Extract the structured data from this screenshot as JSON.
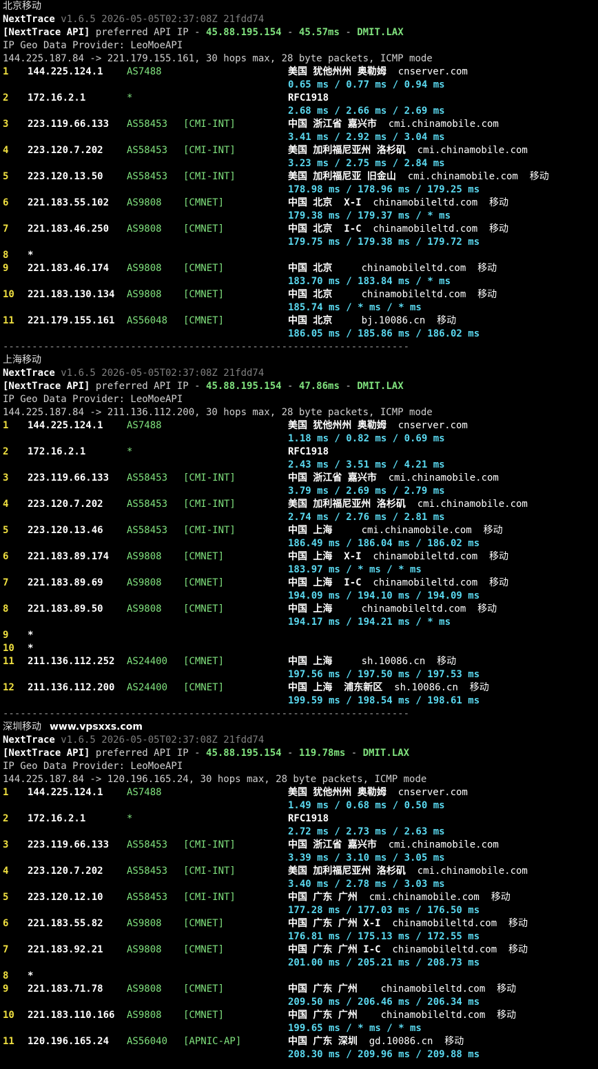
{
  "sections": [
    {
      "name": "北京移动",
      "site": "",
      "banner": {
        "app": "NextTrace",
        "ver": "v1.6.5 2026-05-05T02:37:08Z 21fdd74"
      },
      "api": {
        "label": "[NextTrace API]",
        "mid": " preferred API IP - ",
        "ip": "45.88.195.154",
        "dash1": " - ",
        "latency": "45.57ms",
        "dash2": " - ",
        "pop": "DMIT.LAX"
      },
      "geo_provider": "IP Geo Data Provider: LeoMoeAPI",
      "route": "144.225.187.84 -> 221.179.155.161, 30 hops max, 28 byte packets, ICMP mode",
      "hops": [
        {
          "n": "1",
          "ip": "144.225.124.1",
          "asn": "AS7488",
          "tag": "",
          "geo": "美国 犹他州州 奥勒姆",
          "host": "cnserver.com",
          "isp": "",
          "rtt": "0.65 ms / 0.77 ms / 0.94 ms"
        },
        {
          "n": "2",
          "ip": "172.16.2.1",
          "asn": "*",
          "tag": "",
          "geo": "RFC1918",
          "host": "",
          "isp": "",
          "rtt": "2.68 ms / 2.66 ms / 2.69 ms"
        },
        {
          "n": "3",
          "ip": "223.119.66.133",
          "asn": "AS58453",
          "tag": "[CMI-INT]",
          "geo": "中国 浙江省 嘉兴市",
          "host": "cmi.chinamobile.com",
          "isp": "",
          "rtt": "3.41 ms / 2.92 ms / 3.04 ms"
        },
        {
          "n": "4",
          "ip": "223.120.7.202",
          "asn": "AS58453",
          "tag": "[CMI-INT]",
          "geo": "美国 加利福尼亚州 洛杉矶",
          "host": "cmi.chinamobile.com",
          "isp": "",
          "rtt": "3.23 ms / 2.75 ms / 2.84 ms"
        },
        {
          "n": "5",
          "ip": "223.120.13.50",
          "asn": "AS58453",
          "tag": "[CMI-INT]",
          "geo": "美国 加利福尼亚 旧金山",
          "host": "cmi.chinamobile.com",
          "isp": "移动",
          "rtt": "178.98 ms / 178.96 ms / 179.25 ms"
        },
        {
          "n": "6",
          "ip": "221.183.55.102",
          "asn": "AS9808",
          "tag": "[CMNET]",
          "geo": "中国 北京  X-I",
          "host": "chinamobileltd.com",
          "isp": "移动",
          "rtt": "179.38 ms / 179.37 ms / * ms"
        },
        {
          "n": "7",
          "ip": "221.183.46.250",
          "asn": "AS9808",
          "tag": "[CMNET]",
          "geo": "中国 北京  I-C",
          "host": "chinamobileltd.com",
          "isp": "移动",
          "rtt": "179.75 ms / 179.38 ms / 179.72 ms"
        },
        {
          "n": "8",
          "ip": "*",
          "asn": "",
          "tag": "",
          "geo": "",
          "host": "",
          "isp": "",
          "rtt": ""
        },
        {
          "n": "9",
          "ip": "221.183.46.174",
          "asn": "AS9808",
          "tag": "[CMNET]",
          "geo": "中国 北京   ",
          "host": "chinamobileltd.com",
          "isp": "移动",
          "rtt": "183.70 ms / 183.84 ms / * ms"
        },
        {
          "n": "10",
          "ip": "221.183.130.134",
          "asn": "AS9808",
          "tag": "[CMNET]",
          "geo": "中国 北京   ",
          "host": "chinamobileltd.com",
          "isp": "移动",
          "rtt": "185.74 ms / * ms / * ms"
        },
        {
          "n": "11",
          "ip": "221.179.155.161",
          "asn": "AS56048",
          "tag": "[CMNET]",
          "geo": "中国 北京   ",
          "host": "bj.10086.cn",
          "isp": "移动",
          "rtt": "186.05 ms / 185.86 ms / 186.02 ms"
        }
      ]
    },
    {
      "name": "上海移动",
      "site": "",
      "banner": {
        "app": "NextTrace",
        "ver": "v1.6.5 2026-05-05T02:37:08Z 21fdd74"
      },
      "api": {
        "label": "[NextTrace API]",
        "mid": " preferred API IP - ",
        "ip": "45.88.195.154",
        "dash1": " - ",
        "latency": "47.86ms",
        "dash2": " - ",
        "pop": "DMIT.LAX"
      },
      "geo_provider": "IP Geo Data Provider: LeoMoeAPI",
      "route": "144.225.187.84 -> 211.136.112.200, 30 hops max, 28 byte packets, ICMP mode",
      "hops": [
        {
          "n": "1",
          "ip": "144.225.124.1",
          "asn": "AS7488",
          "tag": "",
          "geo": "美国 犹他州州 奥勒姆",
          "host": "cnserver.com",
          "isp": "",
          "rtt": "1.18 ms / 0.82 ms / 0.69 ms"
        },
        {
          "n": "2",
          "ip": "172.16.2.1",
          "asn": "*",
          "tag": "",
          "geo": "RFC1918",
          "host": "",
          "isp": "",
          "rtt": "2.43 ms / 3.51 ms / 4.21 ms"
        },
        {
          "n": "3",
          "ip": "223.119.66.133",
          "asn": "AS58453",
          "tag": "[CMI-INT]",
          "geo": "中国 浙江省 嘉兴市",
          "host": "cmi.chinamobile.com",
          "isp": "",
          "rtt": "3.79 ms / 2.69 ms / 2.79 ms"
        },
        {
          "n": "4",
          "ip": "223.120.7.202",
          "asn": "AS58453",
          "tag": "[CMI-INT]",
          "geo": "美国 加利福尼亚州 洛杉矶",
          "host": "cmi.chinamobile.com",
          "isp": "",
          "rtt": "2.74 ms / 2.76 ms / 2.81 ms"
        },
        {
          "n": "5",
          "ip": "223.120.13.46",
          "asn": "AS58453",
          "tag": "[CMI-INT]",
          "geo": "中国 上海   ",
          "host": "cmi.chinamobile.com",
          "isp": "移动",
          "rtt": "186.49 ms / 186.04 ms / 186.02 ms"
        },
        {
          "n": "6",
          "ip": "221.183.89.174",
          "asn": "AS9808",
          "tag": "[CMNET]",
          "geo": "中国 上海  X-I",
          "host": "chinamobileltd.com",
          "isp": "移动",
          "rtt": "183.97 ms / * ms / * ms"
        },
        {
          "n": "7",
          "ip": "221.183.89.69",
          "asn": "AS9808",
          "tag": "[CMNET]",
          "geo": "中国 上海  I-C",
          "host": "chinamobileltd.com",
          "isp": "移动",
          "rtt": "194.09 ms / 194.10 ms / 194.09 ms"
        },
        {
          "n": "8",
          "ip": "221.183.89.50",
          "asn": "AS9808",
          "tag": "[CMNET]",
          "geo": "中国 上海   ",
          "host": "chinamobileltd.com",
          "isp": "移动",
          "rtt": "194.17 ms / 194.21 ms / * ms"
        },
        {
          "n": "9",
          "ip": "*",
          "asn": "",
          "tag": "",
          "geo": "",
          "host": "",
          "isp": "",
          "rtt": ""
        },
        {
          "n": "10",
          "ip": "*",
          "asn": "",
          "tag": "",
          "geo": "",
          "host": "",
          "isp": "",
          "rtt": ""
        },
        {
          "n": "11",
          "ip": "211.136.112.252",
          "asn": "AS24400",
          "tag": "[CMNET]",
          "geo": "中国 上海   ",
          "host": "sh.10086.cn",
          "isp": "移动",
          "rtt": "197.56 ms / 197.50 ms / 197.53 ms"
        },
        {
          "n": "12",
          "ip": "211.136.112.200",
          "asn": "AS24400",
          "tag": "[CMNET]",
          "geo": "中国 上海  浦东新区",
          "host": "sh.10086.cn",
          "isp": "移动",
          "rtt": "199.59 ms / 198.54 ms / 198.61 ms"
        }
      ]
    },
    {
      "name": "深圳移动",
      "site": "www.vpsxxs.com",
      "banner": {
        "app": "NextTrace",
        "ver": "v1.6.5 2026-05-05T02:37:08Z 21fdd74"
      },
      "api": {
        "label": "[NextTrace API]",
        "mid": " preferred API IP - ",
        "ip": "45.88.195.154",
        "dash1": " - ",
        "latency": "119.78ms",
        "dash2": " - ",
        "pop": "DMIT.LAX"
      },
      "geo_provider": "IP Geo Data Provider: LeoMoeAPI",
      "route": "144.225.187.84 -> 120.196.165.24, 30 hops max, 28 byte packets, ICMP mode",
      "hops": [
        {
          "n": "1",
          "ip": "144.225.124.1",
          "asn": "AS7488",
          "tag": "",
          "geo": "美国 犹他州州 奥勒姆",
          "host": "cnserver.com",
          "isp": "",
          "rtt": "1.49 ms / 0.68 ms / 0.50 ms"
        },
        {
          "n": "2",
          "ip": "172.16.2.1",
          "asn": "*",
          "tag": "",
          "geo": "RFC1918",
          "host": "",
          "isp": "",
          "rtt": "2.72 ms / 2.73 ms / 2.63 ms"
        },
        {
          "n": "3",
          "ip": "223.119.66.133",
          "asn": "AS58453",
          "tag": "[CMI-INT]",
          "geo": "中国 浙江省 嘉兴市",
          "host": "cmi.chinamobile.com",
          "isp": "",
          "rtt": "3.39 ms / 3.10 ms / 3.05 ms"
        },
        {
          "n": "4",
          "ip": "223.120.7.202",
          "asn": "AS58453",
          "tag": "[CMI-INT]",
          "geo": "美国 加利福尼亚州 洛杉矶",
          "host": "cmi.chinamobile.com",
          "isp": "",
          "rtt": "3.40 ms / 2.78 ms / 3.03 ms"
        },
        {
          "n": "5",
          "ip": "223.120.12.10",
          "asn": "AS58453",
          "tag": "[CMI-INT]",
          "geo": "中国 广东 广州",
          "host": "cmi.chinamobile.com",
          "isp": "移动",
          "rtt": "177.28 ms / 177.03 ms / 176.50 ms"
        },
        {
          "n": "6",
          "ip": "221.183.55.82",
          "asn": "AS9808",
          "tag": "[CMNET]",
          "geo": "中国 广东 广州 X-I",
          "host": "chinamobileltd.com",
          "isp": "移动",
          "rtt": "176.81 ms / 175.13 ms / 172.55 ms"
        },
        {
          "n": "7",
          "ip": "221.183.92.21",
          "asn": "AS9808",
          "tag": "[CMNET]",
          "geo": "中国 广东 广州 I-C",
          "host": "chinamobileltd.com",
          "isp": "移动",
          "rtt": "201.00 ms / 205.21 ms / 208.73 ms"
        },
        {
          "n": "8",
          "ip": "*",
          "asn": "",
          "tag": "",
          "geo": "",
          "host": "",
          "isp": "",
          "rtt": ""
        },
        {
          "n": "9",
          "ip": "221.183.71.78",
          "asn": "AS9808",
          "tag": "[CMNET]",
          "geo": "中国 广东 广州  ",
          "host": "chinamobileltd.com",
          "isp": "移动",
          "rtt": "209.50 ms / 206.46 ms / 206.34 ms"
        },
        {
          "n": "10",
          "ip": "221.183.110.166",
          "asn": "AS9808",
          "tag": "[CMNET]",
          "geo": "中国 广东 广州  ",
          "host": "chinamobileltd.com",
          "isp": "移动",
          "rtt": "199.65 ms / * ms / * ms"
        },
        {
          "n": "11",
          "ip": "120.196.165.24",
          "asn": "AS56040",
          "tag": "[APNIC-AP]",
          "geo": "中国 广东 深圳",
          "host": "gd.10086.cn",
          "isp": "移动",
          "rtt": "208.30 ms / 209.96 ms / 209.88 ms"
        }
      ]
    }
  ],
  "separator": "----------------------------------------------------------------------"
}
